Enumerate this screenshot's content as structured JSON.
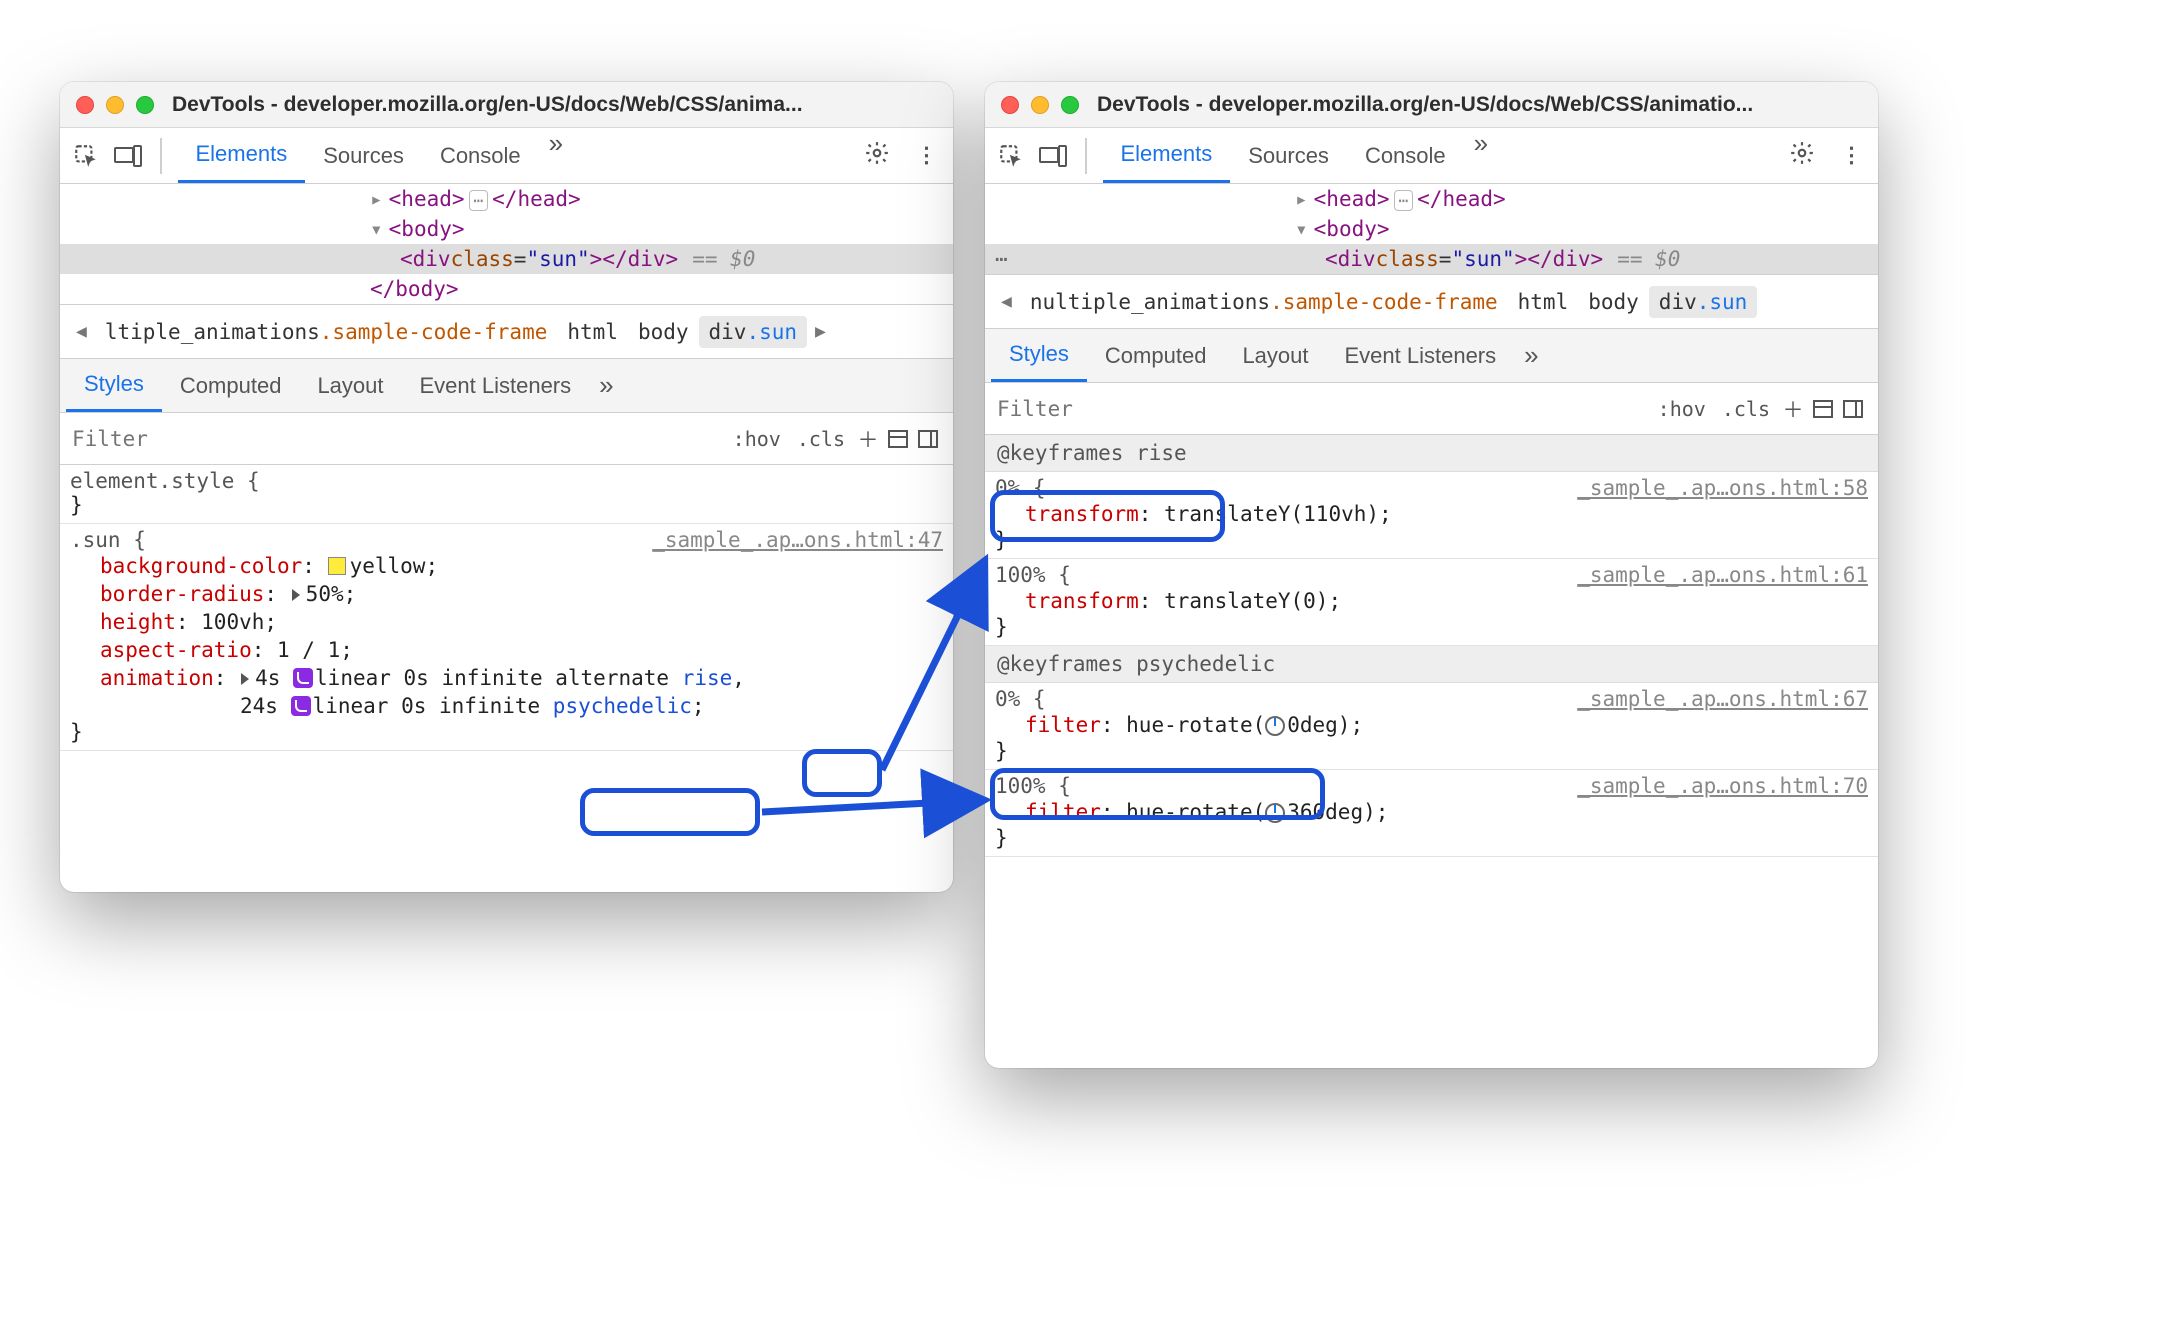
{
  "window1": {
    "title": "DevTools - developer.mozilla.org/en-US/docs/Web/CSS/anima...",
    "tabs": {
      "elements": "Elements",
      "sources": "Sources",
      "console": "Console"
    },
    "dom": {
      "head_open": "<head>",
      "head_close": "</head>",
      "body_open": "<body>",
      "body_close": "</body>",
      "div_open": "<div ",
      "class_attr": "class",
      "class_val": "\"sun\"",
      "div_close_inline": "></div>",
      "eq": "== $0"
    },
    "crumbs": {
      "first": "ltiple_animations",
      "frame": ".sample-code-frame",
      "html": "html",
      "body": "body",
      "divsun": "div.sun"
    },
    "subtabs": {
      "styles": "Styles",
      "computed": "Computed",
      "layout": "Layout",
      "el": "Event Listeners"
    },
    "filter": {
      "placeholder": "Filter",
      "hov": ":hov",
      "cls": ".cls"
    },
    "styles": {
      "elstyle": "element.style {",
      "sun_sel": ".sun {",
      "src1": "_sample_.ap…ons.html:47",
      "p_bg": "background-color",
      "v_bg": "yellow",
      "p_br": "border-radius",
      "v_br": "50%",
      "p_h": "height",
      "v_h": "100vh",
      "p_ar": "aspect-ratio",
      "v_ar": "1 / 1",
      "p_anim": "animation",
      "anim1_a": "4s ",
      "anim1_b": "linear 0s infinite alternate ",
      "anim1_name": "rise",
      "anim2_a": "24s ",
      "anim2_b": "linear 0s infinite ",
      "anim2_name": "psychedelic",
      "close": "}"
    }
  },
  "window2": {
    "title": "DevTools - developer.mozilla.org/en-US/docs/Web/CSS/animatio...",
    "crumbs": {
      "first": "nultiple_animations",
      "frame": ".sample-code-frame",
      "html": "html",
      "body": "body",
      "divsun": "div.sun"
    },
    "kf": {
      "rise_head": "@keyframes rise",
      "kf0": "0% {",
      "kf100": "100% {",
      "src_rise0": "_sample_.ap…ons.html:58",
      "src_rise100": "_sample_.ap…ons.html:61",
      "p_tr": "transform",
      "v_tr0": "translateY(110vh)",
      "v_tr100": "translateY(0)",
      "psy_head": "@keyframes psychedelic",
      "src_psy0": "_sample_.ap…ons.html:67",
      "src_psy100": "_sample_.ap…ons.html:70",
      "p_fl": "filter",
      "v_fl0_a": "hue-rotate(",
      "v_fl0_b": "0deg)",
      "v_fl100_a": "hue-rotate(",
      "v_fl100_b": "360deg)",
      "close": "}"
    }
  }
}
